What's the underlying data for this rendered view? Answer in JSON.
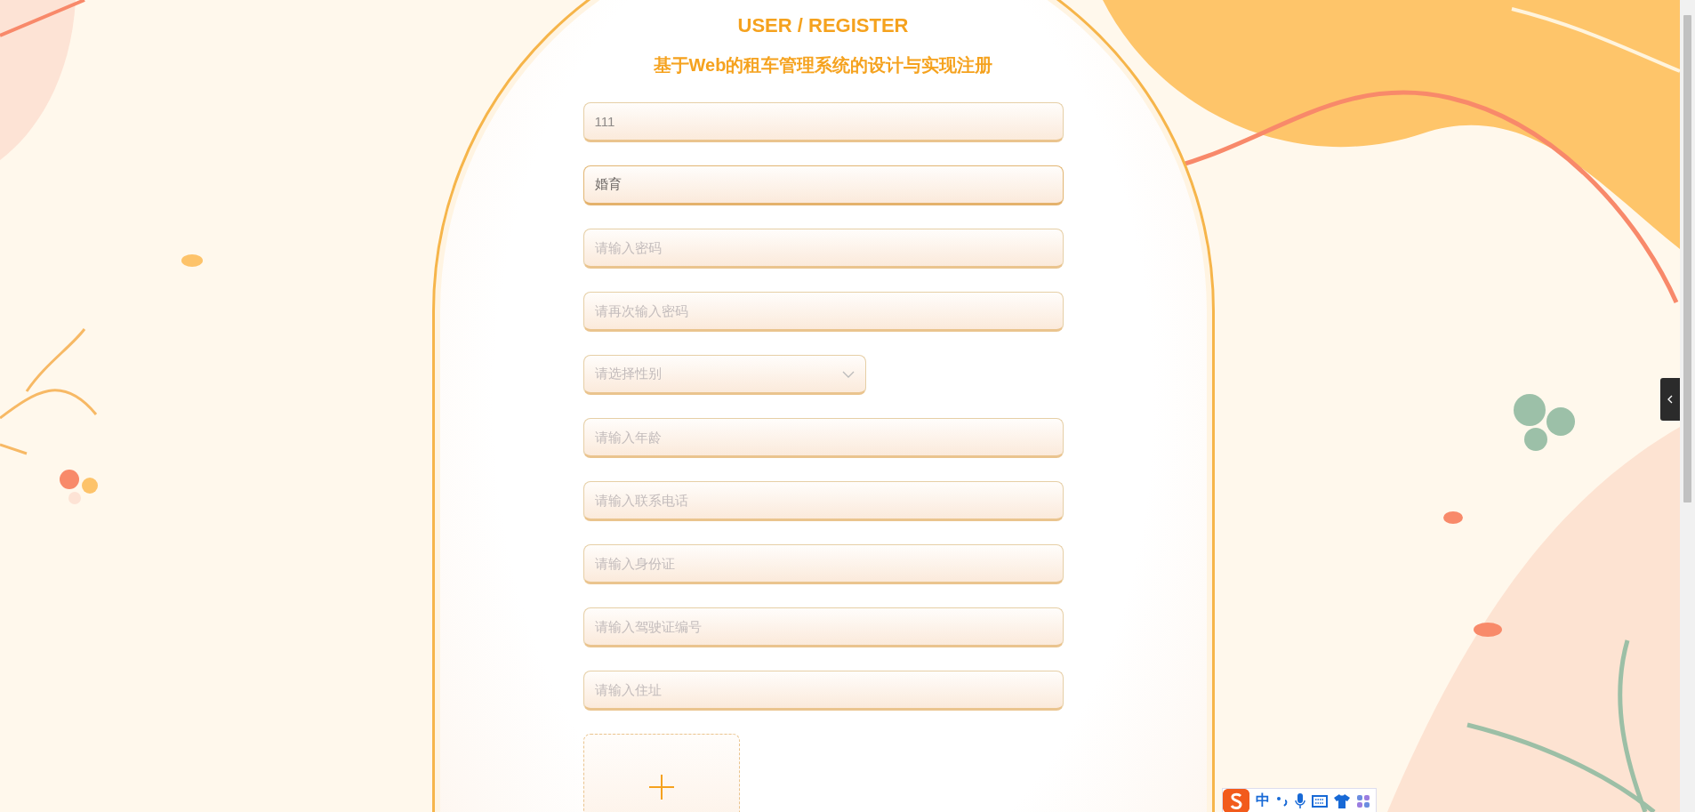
{
  "form": {
    "title": "USER / REGISTER",
    "subtitle": "基于Web的租车管理系统的设计与实现注册",
    "fields": [
      {
        "kind": "text",
        "value": "111",
        "focused": false
      },
      {
        "kind": "text",
        "value": "婚育",
        "focused": true
      },
      {
        "kind": "text",
        "placeholder": "请输入密码",
        "focused": false
      },
      {
        "kind": "text",
        "placeholder": "请再次输入密码",
        "focused": false
      },
      {
        "kind": "select",
        "placeholder": "请选择性别",
        "focused": false
      },
      {
        "kind": "text",
        "placeholder": "请输入年龄",
        "focused": false
      },
      {
        "kind": "text",
        "placeholder": "请输入联系电话",
        "focused": false
      },
      {
        "kind": "text",
        "placeholder": "请输入身份证",
        "focused": false
      },
      {
        "kind": "text",
        "placeholder": "请输入驾驶证编号",
        "focused": false
      },
      {
        "kind": "text",
        "placeholder": "请输入住址",
        "focused": false
      },
      {
        "kind": "upload",
        "focused": false
      }
    ]
  },
  "ime_bar": {
    "mode": "中"
  }
}
